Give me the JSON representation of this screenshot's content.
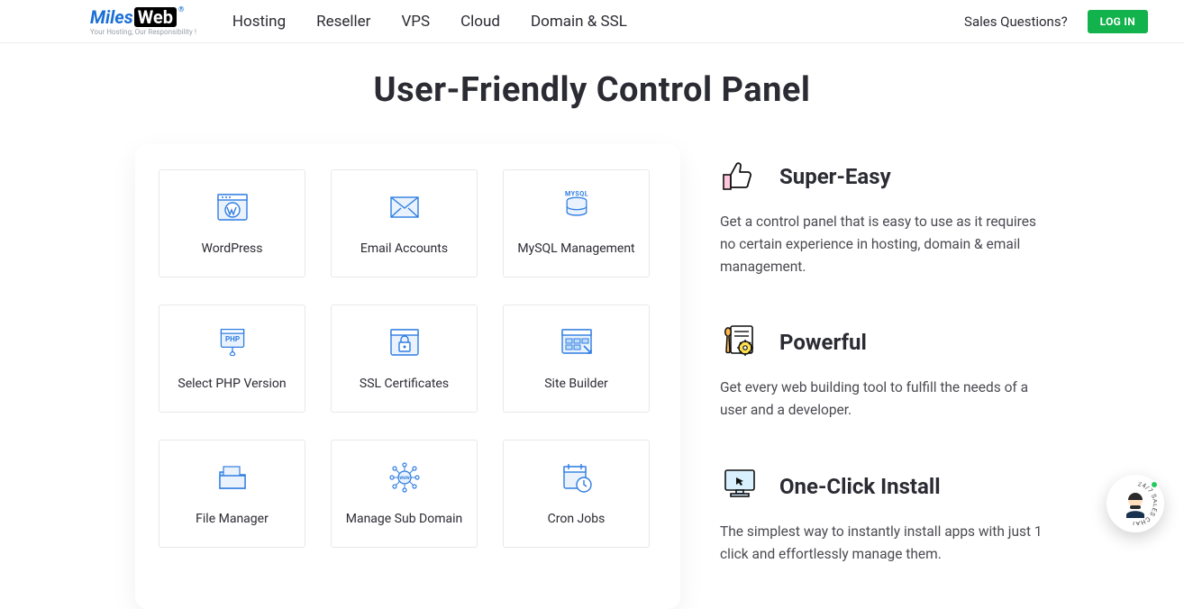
{
  "logo": {
    "left": "Miles",
    "right": "Web",
    "reg": "®",
    "tag": "Your Hosting, Our Responsibility !"
  },
  "nav": {
    "hosting": "Hosting",
    "reseller": "Reseller",
    "vps": "VPS",
    "cloud": "Cloud",
    "domain": "Domain & SSL"
  },
  "top": {
    "sales": "Sales Questions?",
    "login": "LOG IN"
  },
  "hero": "User-Friendly Control Panel",
  "tiles": {
    "wordpress": "WordPress",
    "email": "Email Accounts",
    "mysql": "MySQL Management",
    "mysql_badge": "MYSQL",
    "php": "Select PHP Version",
    "php_badge": "PHP",
    "ssl": "SSL Certificates",
    "builder": "Site Builder",
    "file": "File Manager",
    "subdomain": "Manage Sub Domain",
    "subdomain_badge": "WWW",
    "cron": "Cron Jobs"
  },
  "feat": {
    "easy": {
      "title": "Super-Easy",
      "desc": "Get a control panel that is easy to use as it requires no certain experience in hosting, domain & email management."
    },
    "power": {
      "title": "Powerful",
      "desc": "Get every web building tool to fulfill the needs of a user and a developer."
    },
    "oneclick": {
      "title": "One-Click Install",
      "desc": "The simplest way to instantly install apps with just 1 click and effortlessly manage them."
    }
  },
  "chat": {
    "label": "24/7 SALES CHAT"
  }
}
